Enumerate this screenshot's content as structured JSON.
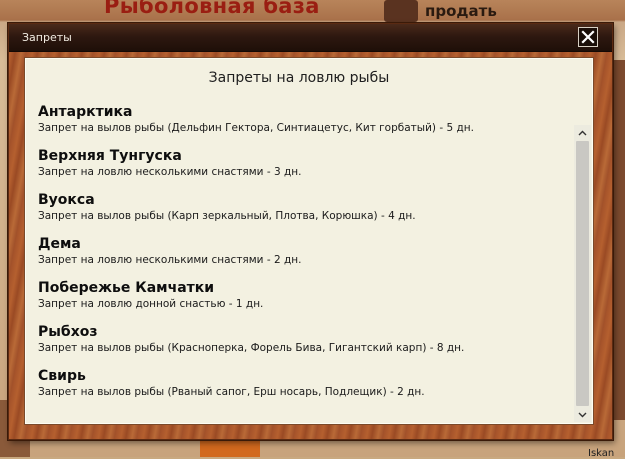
{
  "background": {
    "title": "Рыболовная база",
    "sell_label": "продать",
    "bottom_right_text": "Iskan"
  },
  "window": {
    "title": "Запреты",
    "close_icon": "close-icon"
  },
  "panel": {
    "header": "Запреты на ловлю рыбы"
  },
  "bans": [
    {
      "name": "Антарктика",
      "description": "Запрет на вылов рыбы (Дельфин Гектора, Синтиацетус, Кит горбатый)  - 5 дн."
    },
    {
      "name": "Верхняя Тунгуска",
      "description": "Запрет на ловлю несколькими снастями - 3 дн."
    },
    {
      "name": "Вуокса",
      "description": "Запрет на вылов рыбы (Карп зеркальный, Плотва, Корюшка)  - 4 дн."
    },
    {
      "name": "Дема",
      "description": "Запрет на ловлю несколькими снастями - 2 дн."
    },
    {
      "name": "Побережье Камчатки",
      "description": "Запрет на ловлю донной снастью - 1 дн."
    },
    {
      "name": "Рыбхоз",
      "description": "Запрет на вылов рыбы (Красноперка, Форель Бива, Гигантский карп)  - 8 дн."
    },
    {
      "name": "Свирь",
      "description": "Запрет на вылов рыбы (Рваный сапог, Ерш носарь, Подлещик)  - 2 дн."
    }
  ],
  "scrollbar": {
    "up_icon": "chevron-up-icon",
    "down_icon": "chevron-down-icon"
  }
}
